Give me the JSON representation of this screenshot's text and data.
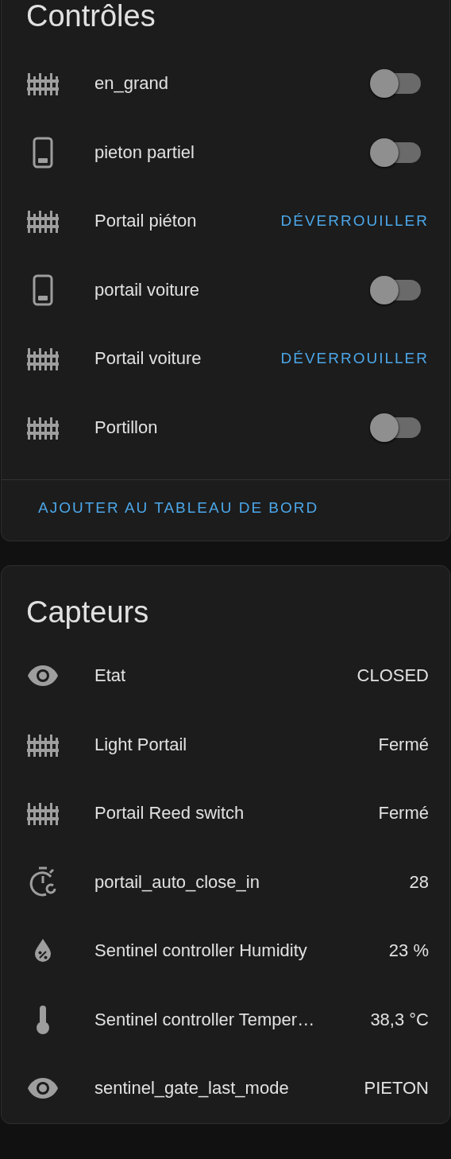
{
  "controls": {
    "title": "Contrôles",
    "rows": [
      {
        "name": "en_grand",
        "kind": "toggle",
        "on": false
      },
      {
        "name": "pieton partiel",
        "kind": "toggle",
        "on": false
      },
      {
        "name": "Portail piéton",
        "kind": "action",
        "action": "DÉVERROUILLER"
      },
      {
        "name": "portail voiture",
        "kind": "toggle",
        "on": false
      },
      {
        "name": "Portail voiture",
        "kind": "action",
        "action": "DÉVERROUILLER"
      },
      {
        "name": "Portillon",
        "kind": "toggle",
        "on": false
      }
    ],
    "footer_button": "AJOUTER AU TABLEAU DE BORD"
  },
  "sensors": {
    "title": "Capteurs",
    "rows": [
      {
        "name": "Etat",
        "value": "CLOSED"
      },
      {
        "name": "Light Portail",
        "value": "Fermé"
      },
      {
        "name": "Portail Reed switch",
        "value": "Fermé"
      },
      {
        "name": "portail_auto_close_in",
        "value": "28"
      },
      {
        "name": "Sentinel controller Humidity",
        "value": "23 %"
      },
      {
        "name": "Sentinel controller Temper…",
        "value": "38,3 °C"
      },
      {
        "name": "sentinel_gate_last_mode",
        "value": "PIETON"
      }
    ]
  }
}
